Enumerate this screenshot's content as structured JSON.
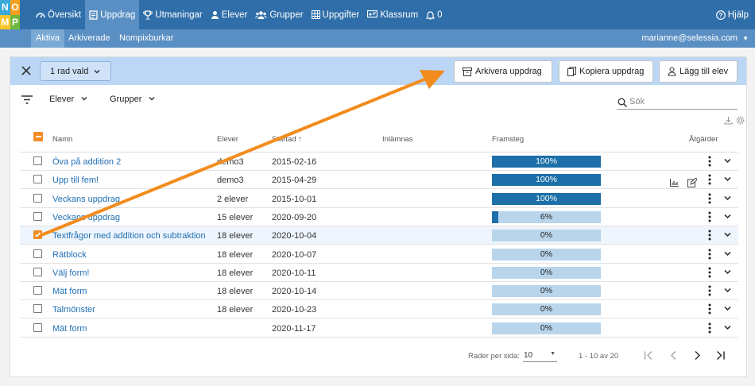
{
  "logo": {
    "letters": [
      "N",
      "O",
      "M",
      "P"
    ],
    "colors": [
      "#3aa8d8",
      "#f7a01e",
      "#f9c52a",
      "#6fb73d"
    ]
  },
  "nav": {
    "items": [
      {
        "label": "Översikt",
        "icon": "gauge-icon",
        "active": false
      },
      {
        "label": "Uppdrag",
        "icon": "clipboard-icon",
        "active": true
      },
      {
        "label": "Utmaningar",
        "icon": "trophy-icon",
        "active": false
      },
      {
        "label": "Elever",
        "icon": "user-icon",
        "active": false
      },
      {
        "label": "Grupper",
        "icon": "group-icon",
        "active": false
      },
      {
        "label": "Uppgifter",
        "icon": "grid-icon",
        "active": false
      },
      {
        "label": "Klassrum",
        "icon": "classroom-icon",
        "active": false
      },
      {
        "label": "0",
        "icon": "bell-icon",
        "active": false
      }
    ],
    "help": "Hjälp"
  },
  "subnav": {
    "items": [
      "Aktiva",
      "Arkiverade",
      "Nompixburkar"
    ],
    "active": 0,
    "user": "marianne@selessia.com"
  },
  "selection": {
    "label": "1 rad vald",
    "buttons": [
      "Arkivera uppdrag",
      "Kopiera uppdrag",
      "Lägg till elev"
    ]
  },
  "filters": {
    "students": "Elever",
    "groups": "Grupper",
    "search_placeholder": "Sök"
  },
  "table": {
    "headers": {
      "name": "Namn",
      "students": "Elever",
      "started": "Startad",
      "submitted": "Inlämnas",
      "progress": "Framsteg",
      "actions": "Åtgärder"
    },
    "rows": [
      {
        "name": "Öva på addition 2",
        "students": "demo3",
        "started": "2015-02-16",
        "progress": 100,
        "progress_label": "100%",
        "selected": false
      },
      {
        "name": "Upp till fem!",
        "students": "demo3",
        "started": "2015-04-29",
        "progress": 100,
        "progress_label": "100%",
        "selected": false
      },
      {
        "name": "Veckans uppdrag",
        "students": "2 elever",
        "started": "2015-10-01",
        "progress": 100,
        "progress_label": "100%",
        "selected": false
      },
      {
        "name": "Veckans uppdrag",
        "students": "15 elever",
        "started": "2020-09-20",
        "progress": 6,
        "progress_label": "6%",
        "selected": false
      },
      {
        "name": "Textfrågor med addition och subtraktion",
        "students": "18 elever",
        "started": "2020-10-04",
        "progress": 0,
        "progress_label": "0%",
        "selected": true
      },
      {
        "name": "Rätblock",
        "students": "18 elever",
        "started": "2020-10-07",
        "progress": 0,
        "progress_label": "0%",
        "selected": false
      },
      {
        "name": "Välj form!",
        "students": "18 elever",
        "started": "2020-10-11",
        "progress": 0,
        "progress_label": "0%",
        "selected": false
      },
      {
        "name": "Mät form",
        "students": "18 elever",
        "started": "2020-10-14",
        "progress": 0,
        "progress_label": "0%",
        "selected": false
      },
      {
        "name": "Talmönster",
        "students": "18 elever",
        "started": "2020-10-23",
        "progress": 0,
        "progress_label": "0%",
        "selected": false
      },
      {
        "name": "Mät form",
        "students": "",
        "started": "2020-11-17",
        "progress": 0,
        "progress_label": "0%",
        "selected": false
      }
    ]
  },
  "pagination": {
    "rows_per_page_label": "Rader per sida:",
    "rows_per_page": "10",
    "range": "1 - 10 av 20"
  },
  "colors": {
    "topbar": "#2f6ea9",
    "accent": "#f28c28",
    "progress": "#1c6fa8"
  }
}
